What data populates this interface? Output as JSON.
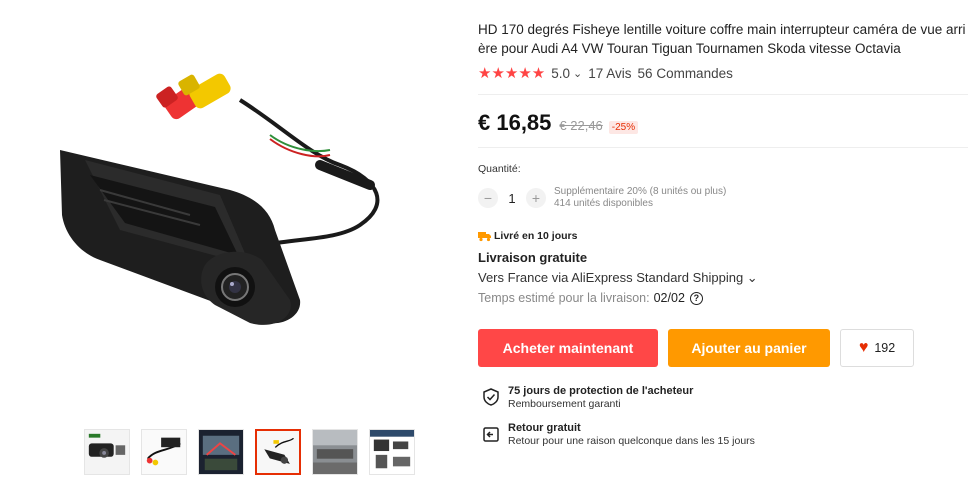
{
  "product": {
    "title": "HD 170 degrés Fisheye lentille voiture coffre main interrupteur caméra de vue arrière pour Audi A4 VW Touran Tiguan Tournamen Skoda vitesse Octavia",
    "stars": "★★★★★",
    "rating": "5.0",
    "rating_chevron": "⌄",
    "reviews": "17 Avis",
    "orders": "56 Commandes"
  },
  "price": {
    "current": "€ 16,85",
    "original": "€ 22,46",
    "discount": "-25%"
  },
  "quantity": {
    "label": "Quantité:",
    "minus": "−",
    "value": "1",
    "plus": "+",
    "bulk_info": "Supplémentaire 20% (8 unités ou plus)",
    "stock": "414 unités disponibles"
  },
  "delivery": {
    "badge": "Livré en 10 jours",
    "free_shipping": "Livraison gratuite",
    "via": "Vers France via AliExpress Standard Shipping ⌄",
    "estimate_label": "Temps estimé pour la livraison:",
    "estimate_date": "02/02",
    "help_glyph": "?"
  },
  "actions": {
    "buy_now": "Acheter maintenant",
    "add_to_cart": "Ajouter au panier",
    "wishlist_icon": "♥",
    "wishlist_count": "192"
  },
  "guarantees": [
    {
      "title": "75 jours de protection de l'acheteur",
      "subtitle": "Remboursement garanti"
    },
    {
      "title": "Retour gratuit",
      "subtitle": "Retour pour une raison quelconque dans les 15 jours"
    }
  ],
  "gallery": {
    "thumbnail_count": 6,
    "active_index": 3
  },
  "colors": {
    "buy": "#ff4747",
    "cart": "#ff9900",
    "stars": "#ff4747",
    "discount": "#e62e04",
    "active_thumb": "#e62e04"
  }
}
